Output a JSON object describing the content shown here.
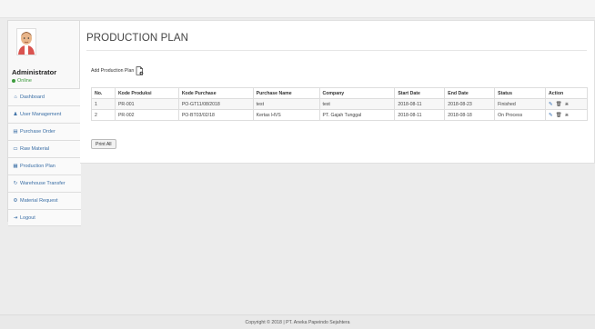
{
  "page": {
    "title": "PRODUCTION PLAN",
    "add_label": "Add Production Plan",
    "print_label": "Print All",
    "footer": "Copyright © 2018 | PT. Aneka Papeindo Sejahtera"
  },
  "user": {
    "name": "Administrator",
    "status": "Online"
  },
  "colors": {
    "link": "#3a6ea5",
    "online": "#3c9b3c",
    "edit_icon": "#2f6db5"
  },
  "sidebar": {
    "items": [
      {
        "label": "Dashboard",
        "icon": "home-icon"
      },
      {
        "label": "User Management",
        "icon": "user-icon"
      },
      {
        "label": "Purchase Order",
        "icon": "cart-icon"
      },
      {
        "label": "Raw Material",
        "icon": "box-icon"
      },
      {
        "label": "Production Plan",
        "icon": "calendar-icon"
      },
      {
        "label": "Warehouse Transfer",
        "icon": "refresh-icon"
      },
      {
        "label": "Material Request",
        "icon": "gear-icon"
      },
      {
        "label": "Logout",
        "icon": "logout-icon"
      }
    ]
  },
  "table": {
    "headers": [
      "No.",
      "Kode Produksi",
      "Kode Purchase",
      "Purchase Name",
      "Company",
      "Start Date",
      "End Date",
      "Status",
      "Action"
    ],
    "rows": [
      [
        "1",
        "PR-001",
        "PO-GT11/08/2018",
        "test",
        "test",
        "2018-08-11",
        "2018-08-23",
        "Finished"
      ],
      [
        "2",
        "PR-002",
        "PO-BT03/02/18",
        "Kertas HVS",
        "PT. Gajah Tunggal",
        "2018-08-11",
        "2018-08-18",
        "On Process"
      ]
    ],
    "action_icons": [
      "edit-icon",
      "trash-icon",
      "more-icon"
    ]
  }
}
